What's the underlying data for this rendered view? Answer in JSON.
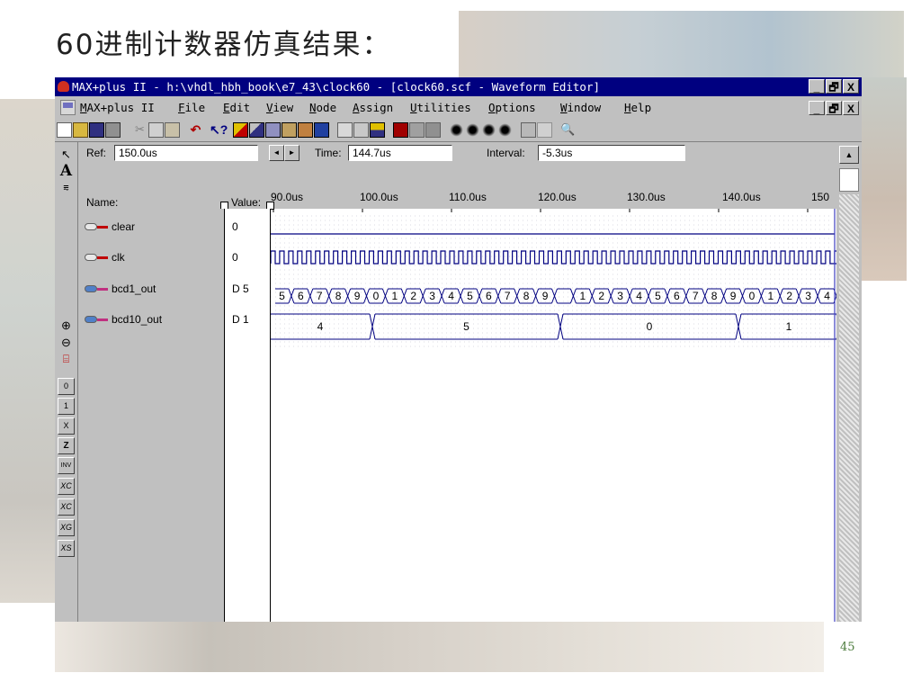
{
  "slide": {
    "title": "60进制计数器仿真结果：",
    "page_number": "45"
  },
  "window": {
    "title": "MAX+plus II - h:\\vhdl_hbh_book\\e7_43\\clock60 - [clock60.scf - Waveform Editor]",
    "controls": [
      "_",
      "🗗",
      "X"
    ]
  },
  "menu": [
    "MAX+plus II",
    "File",
    "Edit",
    "View",
    "Node",
    "Assign",
    "Utilities",
    "Options",
    "Window",
    "Help"
  ],
  "controls": {
    "ref_label": "Ref:",
    "ref_value": "150.0us",
    "time_label": "Time:",
    "time_value": "144.7us",
    "interval_label": "Interval:",
    "interval_value": "-5.3us"
  },
  "columns": {
    "name": "Name:",
    "value": "Value:"
  },
  "time_axis": [
    "90.0us",
    "100.0us",
    "110.0us",
    "120.0us",
    "130.0us",
    "140.0us",
    "150"
  ],
  "signals": [
    {
      "name": "clear",
      "value": "0"
    },
    {
      "name": "clk",
      "value": "0"
    },
    {
      "name": "bcd1_out",
      "value": "D 5"
    },
    {
      "name": "bcd10_out",
      "value": "D 1"
    }
  ],
  "waves": {
    "bcd1_labels": [
      "5",
      "6",
      "7",
      "8",
      "9",
      "0",
      "1",
      "2",
      "3",
      "4",
      "5",
      "6",
      "7",
      "8",
      "9",
      "",
      "1",
      "2",
      "3",
      "4",
      "5",
      "6",
      "7",
      "8",
      "9",
      "0",
      "1",
      "2",
      "3",
      "4"
    ],
    "bcd10_labels": [
      "4",
      "5",
      "0",
      "1"
    ]
  },
  "leftbar_tools": [
    "pointer-tool",
    "text-tool",
    "node-tool",
    "zoom-in-tool",
    "zoom-out-tool",
    "fit-tool",
    "set-0-tool",
    "set-1-tool",
    "set-x-tool",
    "set-z-tool",
    "invert-tool",
    "overwrite-count-tool",
    "overwrite-clock-tool",
    "overwrite-group-tool",
    "overwrite-sequence-tool"
  ]
}
